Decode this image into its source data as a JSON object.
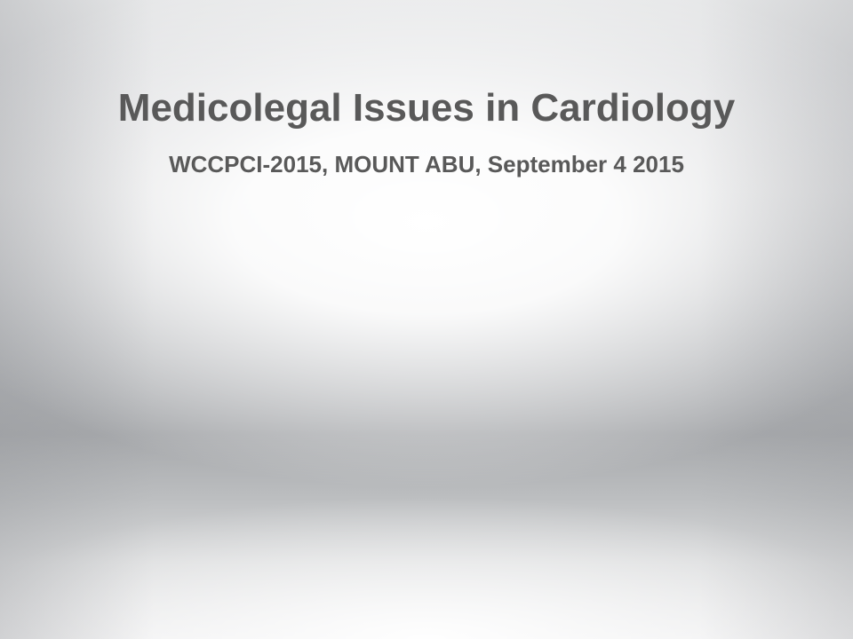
{
  "slide": {
    "title": "Medicolegal Issues in Cardiology",
    "subtitle": "WCCPCI-2015, MOUNT ABU, September 4 2015",
    "colors": {
      "text": "#595959",
      "background_light": "#ffffff",
      "background_dark": "#a6a8ab"
    }
  }
}
